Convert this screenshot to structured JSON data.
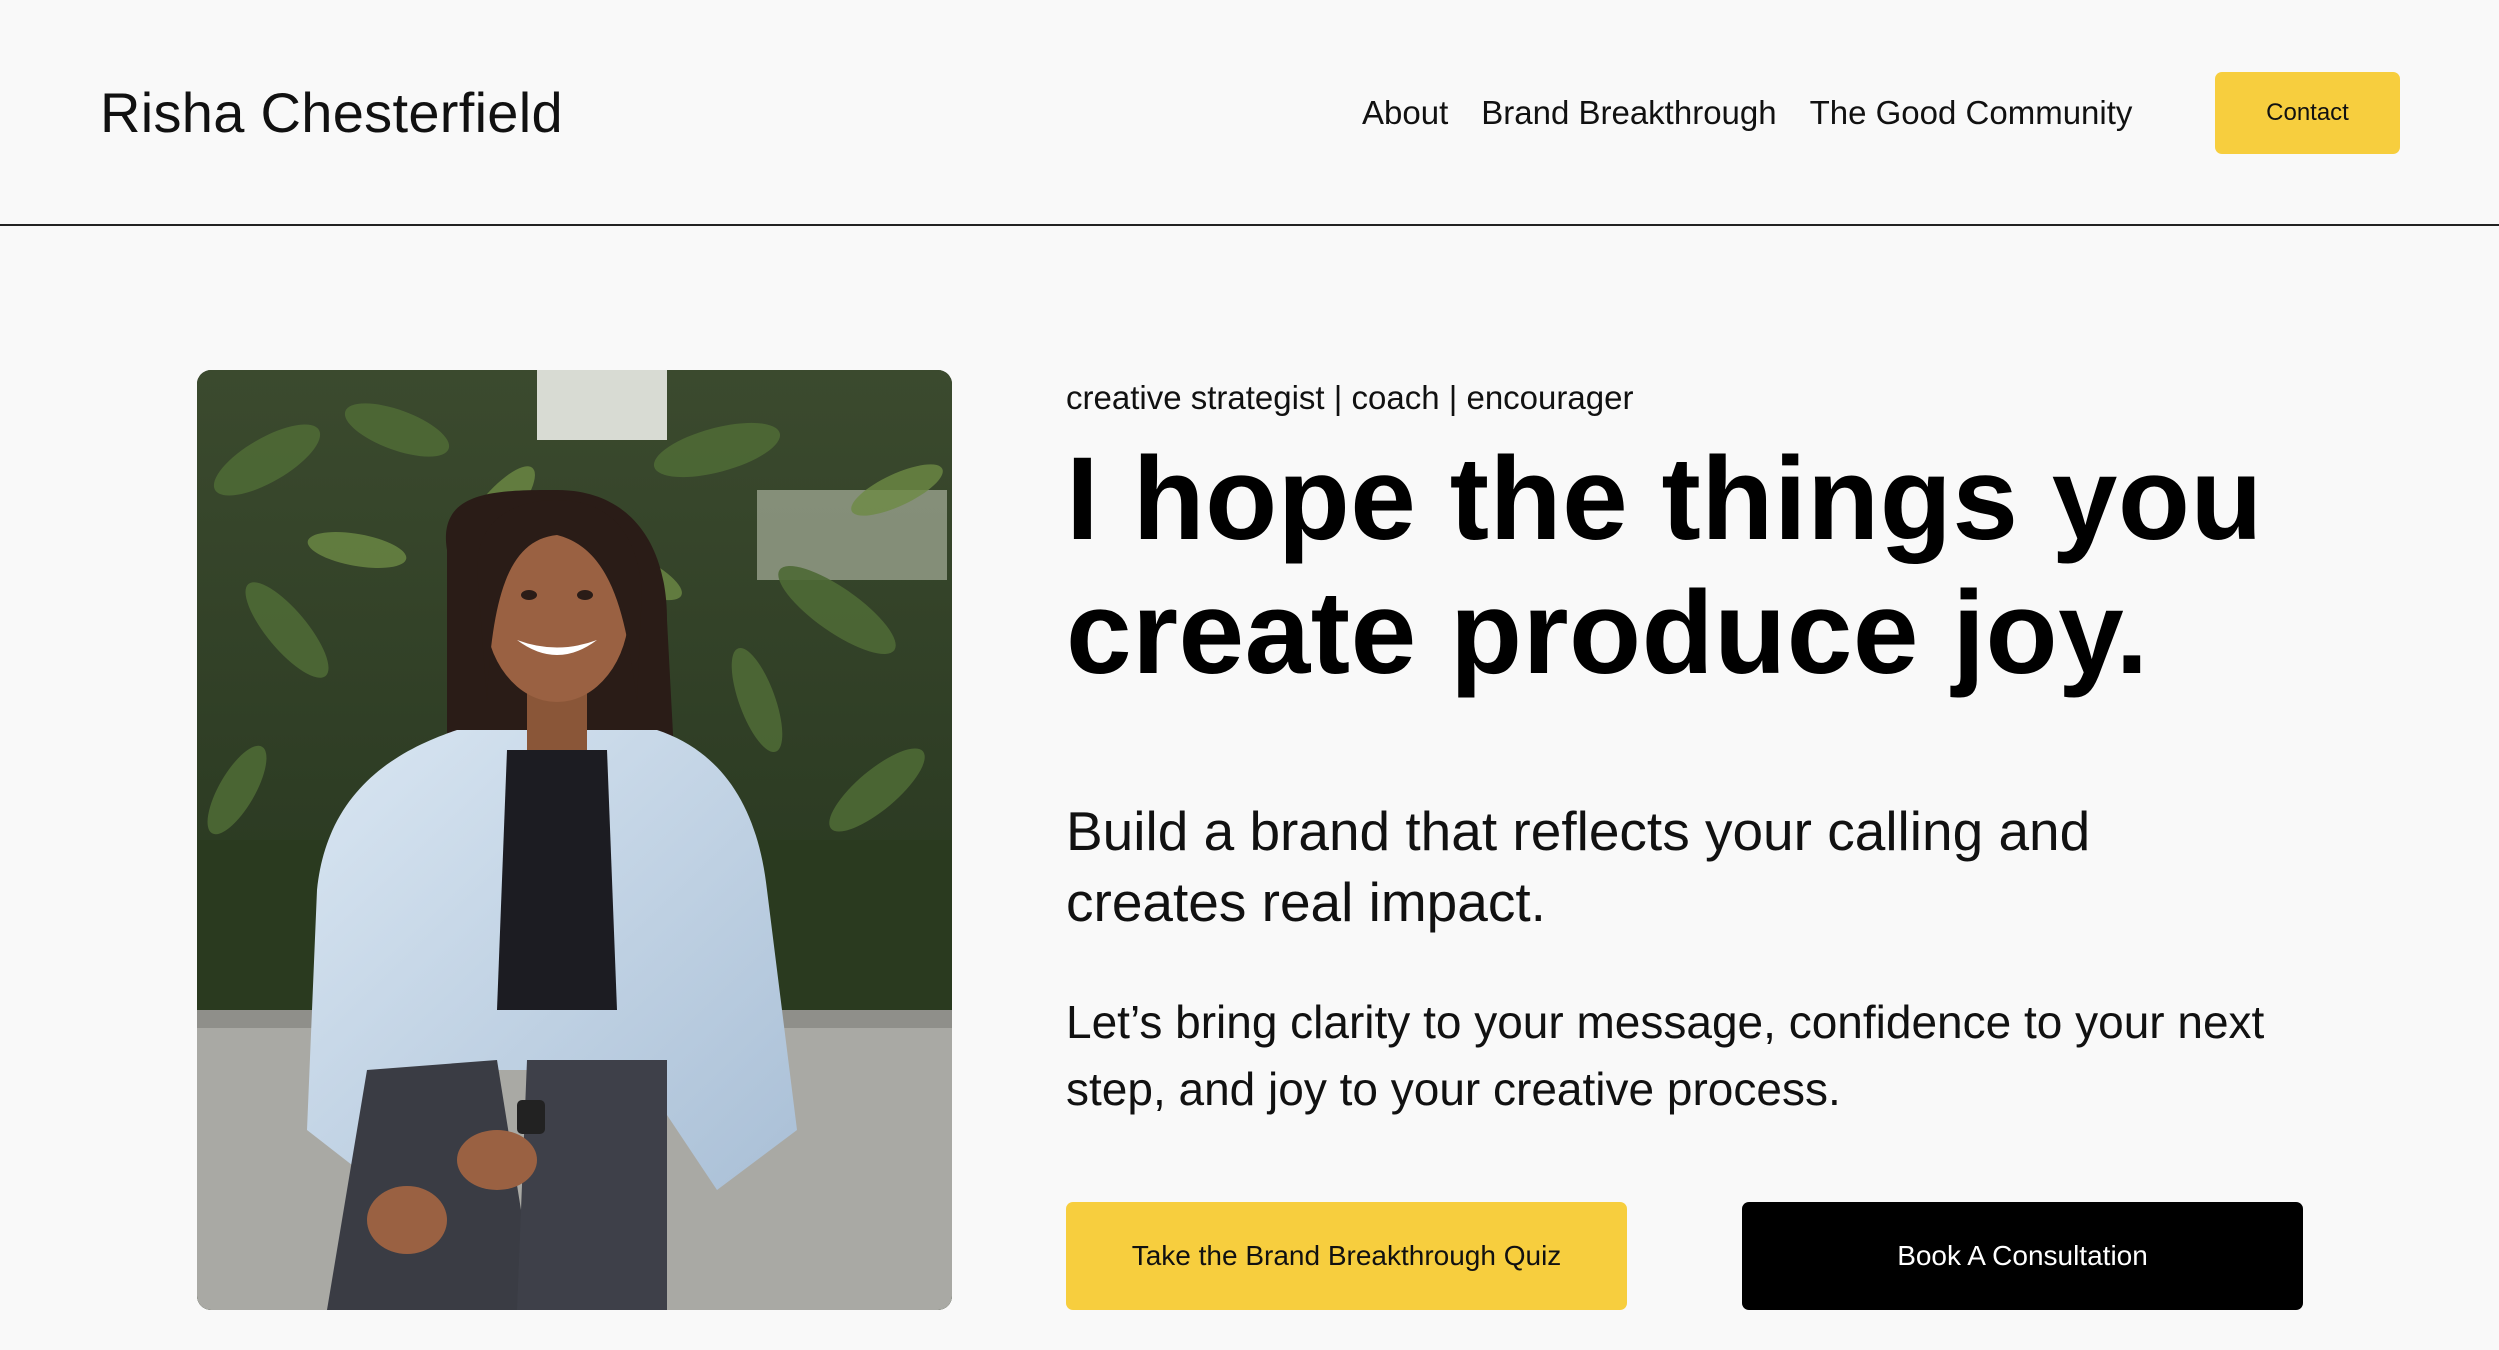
{
  "header": {
    "brand": "Risha Chesterfield",
    "nav": [
      {
        "label": "About"
      },
      {
        "label": "Brand Breakthrough"
      },
      {
        "label": "The Good Community"
      }
    ],
    "contact_label": "Contact"
  },
  "hero": {
    "tagline": "creative strategist  |  coach  | encourager",
    "headline": "I hope the things you create produce joy.",
    "subhead": "Build a brand that reflects your calling and creates real impact.",
    "body": "Let’s bring clarity to your message, confidence to your next step, and joy to your creative process.",
    "cta_primary": "Take the Brand Breakthrough Quiz",
    "cta_secondary": "Book A Consultation",
    "photo_icon": "portrait-photo"
  },
  "colors": {
    "accent": "#f7ce3e",
    "background": "#f9f9f9",
    "text": "#000000",
    "dark_button": "#000000"
  }
}
